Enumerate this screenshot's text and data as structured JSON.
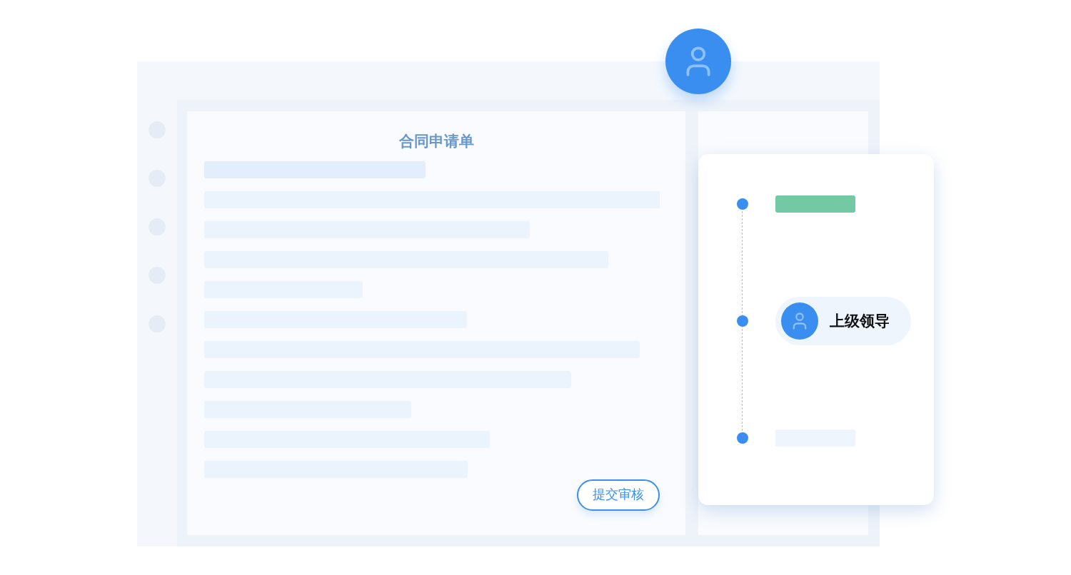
{
  "document": {
    "title": "合同申请单",
    "submit_button": "提交审核"
  },
  "approval_flow": {
    "steps": [
      {
        "kind": "done"
      },
      {
        "kind": "person",
        "label": "上级领导"
      },
      {
        "kind": "pending"
      }
    ]
  }
}
